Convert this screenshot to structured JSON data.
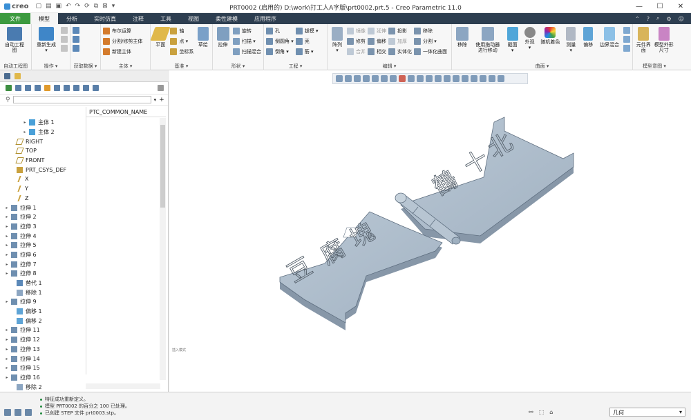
{
  "titlebar": {
    "logo": "creo",
    "title": "PRT0002 (启用的) D:\\work\\打工人A字版\\prt0002.prt.5 - Creo Parametric 11.0",
    "qat_icons": [
      "new-icon",
      "open-icon",
      "save-icon",
      "undo-icon",
      "redo-icon",
      "regenerate-icon",
      "windows-icon",
      "close-window-icon",
      "more-icon"
    ],
    "controls": {
      "minimize": "—",
      "maximize": "☐",
      "close": "✕"
    }
  },
  "tabs": [
    "文件",
    "模型",
    "分析",
    "实时仿真",
    "注释",
    "工具",
    "视图",
    "柔性建模",
    "应用程序"
  ],
  "tab_right_icons": [
    "collapse-icon",
    "help-icon",
    "search-icon",
    "options-icon",
    "user-icon"
  ],
  "ribbon": {
    "groups": [
      {
        "label": "自动工程图",
        "buttons": [
          {
            "label": "自动工程\n图"
          }
        ]
      },
      {
        "label": "操作 ▾",
        "buttons": [
          {
            "label": "重新生成\n▾"
          }
        ],
        "small": [
          "复制",
          "粘贴 ▾",
          "✕ ▾"
        ]
      },
      {
        "label": "获取数据 ▾",
        "small": [
          "用户定义特征",
          "复制几何",
          "收缩包络"
        ]
      },
      {
        "label": "主体 ▾",
        "small": [
          "布尔运算",
          "分割/修剪主体",
          "新建主体"
        ]
      },
      {
        "label": "基准 ▾",
        "buttons": [
          {
            "label": "平面"
          },
          {
            "label": "草绘"
          }
        ],
        "small": [
          "轴",
          "点 ▾",
          "坐标系"
        ]
      },
      {
        "label": "形状 ▾",
        "buttons": [
          {
            "label": "拉伸"
          }
        ],
        "small": [
          "旋转",
          "扫描 ▾",
          "扫描混合"
        ]
      },
      {
        "label": "工程 ▾",
        "small": [
          "孔",
          "倒圆角 ▾",
          "倒角 ▾",
          "拔模 ▾",
          "壳",
          "筋 ▾"
        ]
      },
      {
        "label": "编辑 ▾",
        "buttons": [
          {
            "label": "阵列\n▾"
          }
        ],
        "small": [
          "镜像",
          "修剪",
          "合并",
          "延伸",
          "偏移",
          "相交",
          "投影",
          "加厚",
          "实体化",
          "移除",
          "分割 ▾",
          "一体化曲面"
        ]
      },
      {
        "label": "曲面 ▾",
        "buttons": [
          {
            "label": "移除"
          },
          {
            "label": "使用拖动器\n进行移动"
          },
          {
            "label": "截面\n▾"
          },
          {
            "label": "外观\n▾"
          },
          {
            "label": "随机着色"
          },
          {
            "label": "测量\n▾"
          },
          {
            "label": "偏移"
          },
          {
            "label": "边界混合"
          }
        ]
      },
      {
        "label": "模型意图 ▾",
        "buttons": [
          {
            "label": "元件界面"
          },
          {
            "label": "模型外形\n尺寸"
          }
        ]
      }
    ]
  },
  "tree": {
    "column_header": "PTC_COMMON_NAME",
    "items": [
      {
        "label": "主体 1",
        "arrow": "▸",
        "indent": 2,
        "icon": "body-icon"
      },
      {
        "label": "主体 2",
        "arrow": "▸",
        "indent": 2,
        "icon": "body-icon"
      },
      {
        "label": "RIGHT",
        "arrow": "",
        "indent": 1,
        "icon": "datum-plane-icon"
      },
      {
        "label": "TOP",
        "arrow": "",
        "indent": 1,
        "icon": "datum-plane-icon"
      },
      {
        "label": "FRONT",
        "arrow": "",
        "indent": 1,
        "icon": "datum-plane-icon"
      },
      {
        "label": "PRT_CSYS_DEF",
        "arrow": "",
        "indent": 1,
        "icon": "csys-icon"
      },
      {
        "label": "X",
        "arrow": "",
        "indent": 1,
        "icon": "axis-icon"
      },
      {
        "label": "Y",
        "arrow": "",
        "indent": 1,
        "icon": "axis-icon"
      },
      {
        "label": "Z",
        "arrow": "",
        "indent": 1,
        "icon": "axis-icon"
      },
      {
        "label": "拉伸 1",
        "arrow": "▸",
        "indent": 0,
        "icon": "extrude-icon"
      },
      {
        "label": "拉伸 2",
        "arrow": "▸",
        "indent": 0,
        "icon": "extrude-icon"
      },
      {
        "label": "拉伸 3",
        "arrow": "▸",
        "indent": 0,
        "icon": "extrude-icon"
      },
      {
        "label": "拉伸 4",
        "arrow": "▸",
        "indent": 0,
        "icon": "extrude-icon"
      },
      {
        "label": "拉伸 5",
        "arrow": "▸",
        "indent": 0,
        "icon": "extrude-icon"
      },
      {
        "label": "拉伸 6",
        "arrow": "▸",
        "indent": 0,
        "icon": "extrude-icon"
      },
      {
        "label": "拉伸 7",
        "arrow": "▸",
        "indent": 0,
        "icon": "extrude-icon"
      },
      {
        "label": "拉伸 8",
        "arrow": "▸",
        "indent": 0,
        "icon": "extrude-icon"
      },
      {
        "label": "替代 1",
        "arrow": "",
        "indent": 1,
        "icon": "replace-icon"
      },
      {
        "label": "移除 1",
        "arrow": "",
        "indent": 1,
        "icon": "remove-icon"
      },
      {
        "label": "拉伸 9",
        "arrow": "▸",
        "indent": 0,
        "icon": "extrude-icon"
      },
      {
        "label": "偏移 1",
        "arrow": "",
        "indent": 1,
        "icon": "offset-icon"
      },
      {
        "label": "偏移 2",
        "arrow": "",
        "indent": 1,
        "icon": "offset-icon"
      },
      {
        "label": "拉伸 11",
        "arrow": "▸",
        "indent": 0,
        "icon": "extrude-icon"
      },
      {
        "label": "拉伸 12",
        "arrow": "▸",
        "indent": 0,
        "icon": "extrude-icon"
      },
      {
        "label": "拉伸 13",
        "arrow": "▸",
        "indent": 0,
        "icon": "extrude-icon"
      },
      {
        "label": "拉伸 14",
        "arrow": "▸",
        "indent": 0,
        "icon": "extrude-icon"
      },
      {
        "label": "拉伸 15",
        "arrow": "▸",
        "indent": 0,
        "icon": "extrude-icon"
      },
      {
        "label": "拉伸 16",
        "arrow": "▸",
        "indent": 0,
        "icon": "extrude-icon"
      },
      {
        "label": "移除 2",
        "arrow": "",
        "indent": 1,
        "icon": "remove-icon"
      }
    ]
  },
  "viewport": {
    "watermark": "插入模式",
    "model_text": [
      "豆",
      "腐",
      "塊",
      "十",
      "鶴",
      "北"
    ],
    "model_color": "#a8b8c8"
  },
  "status": {
    "messages": [
      "特征成功重新定义。",
      "模型 PRT0002 的百分之 100 已处理。",
      "已创建 STEP 文件 prt0003.stp。"
    ],
    "selection_filter": "几何",
    "icons": [
      "message-log-icon",
      "toggle-tree-icon",
      "toggle-browser-icon"
    ]
  },
  "colors": {
    "file_tab": "#3c9a3f",
    "tabbar": "#2d3e50",
    "accent": "#3a8fd6"
  }
}
